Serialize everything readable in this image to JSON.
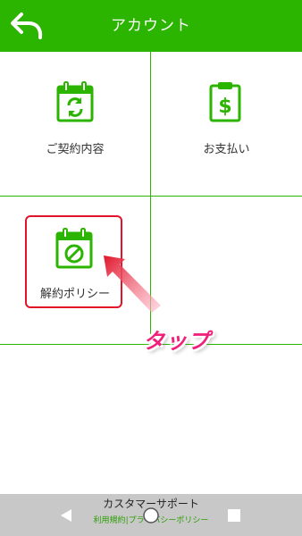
{
  "header": {
    "title": "アカウント",
    "back_icon": "back-arrow-icon",
    "background": "#2bb400"
  },
  "menu": [
    {
      "label": "ご契約内容",
      "icon": "calendar-refresh-icon"
    },
    {
      "label": "お支払い",
      "icon": "clipboard-dollar-icon"
    },
    {
      "label": "解約ポリシー",
      "icon": "calendar-cancel-icon"
    }
  ],
  "annotation": {
    "tap_text": "タップ",
    "highlight_color": "#e0152a",
    "text_color": "#f0207a"
  },
  "footer": {
    "support": "カスタマーサポート",
    "terms": "利用規約",
    "separator": "|",
    "privacy": "プライバシーポリシー",
    "link_color": "#2a9d00"
  },
  "system_nav": {
    "back": "nav-back-icon",
    "home": "nav-home-icon",
    "recents": "nav-recents-icon"
  }
}
